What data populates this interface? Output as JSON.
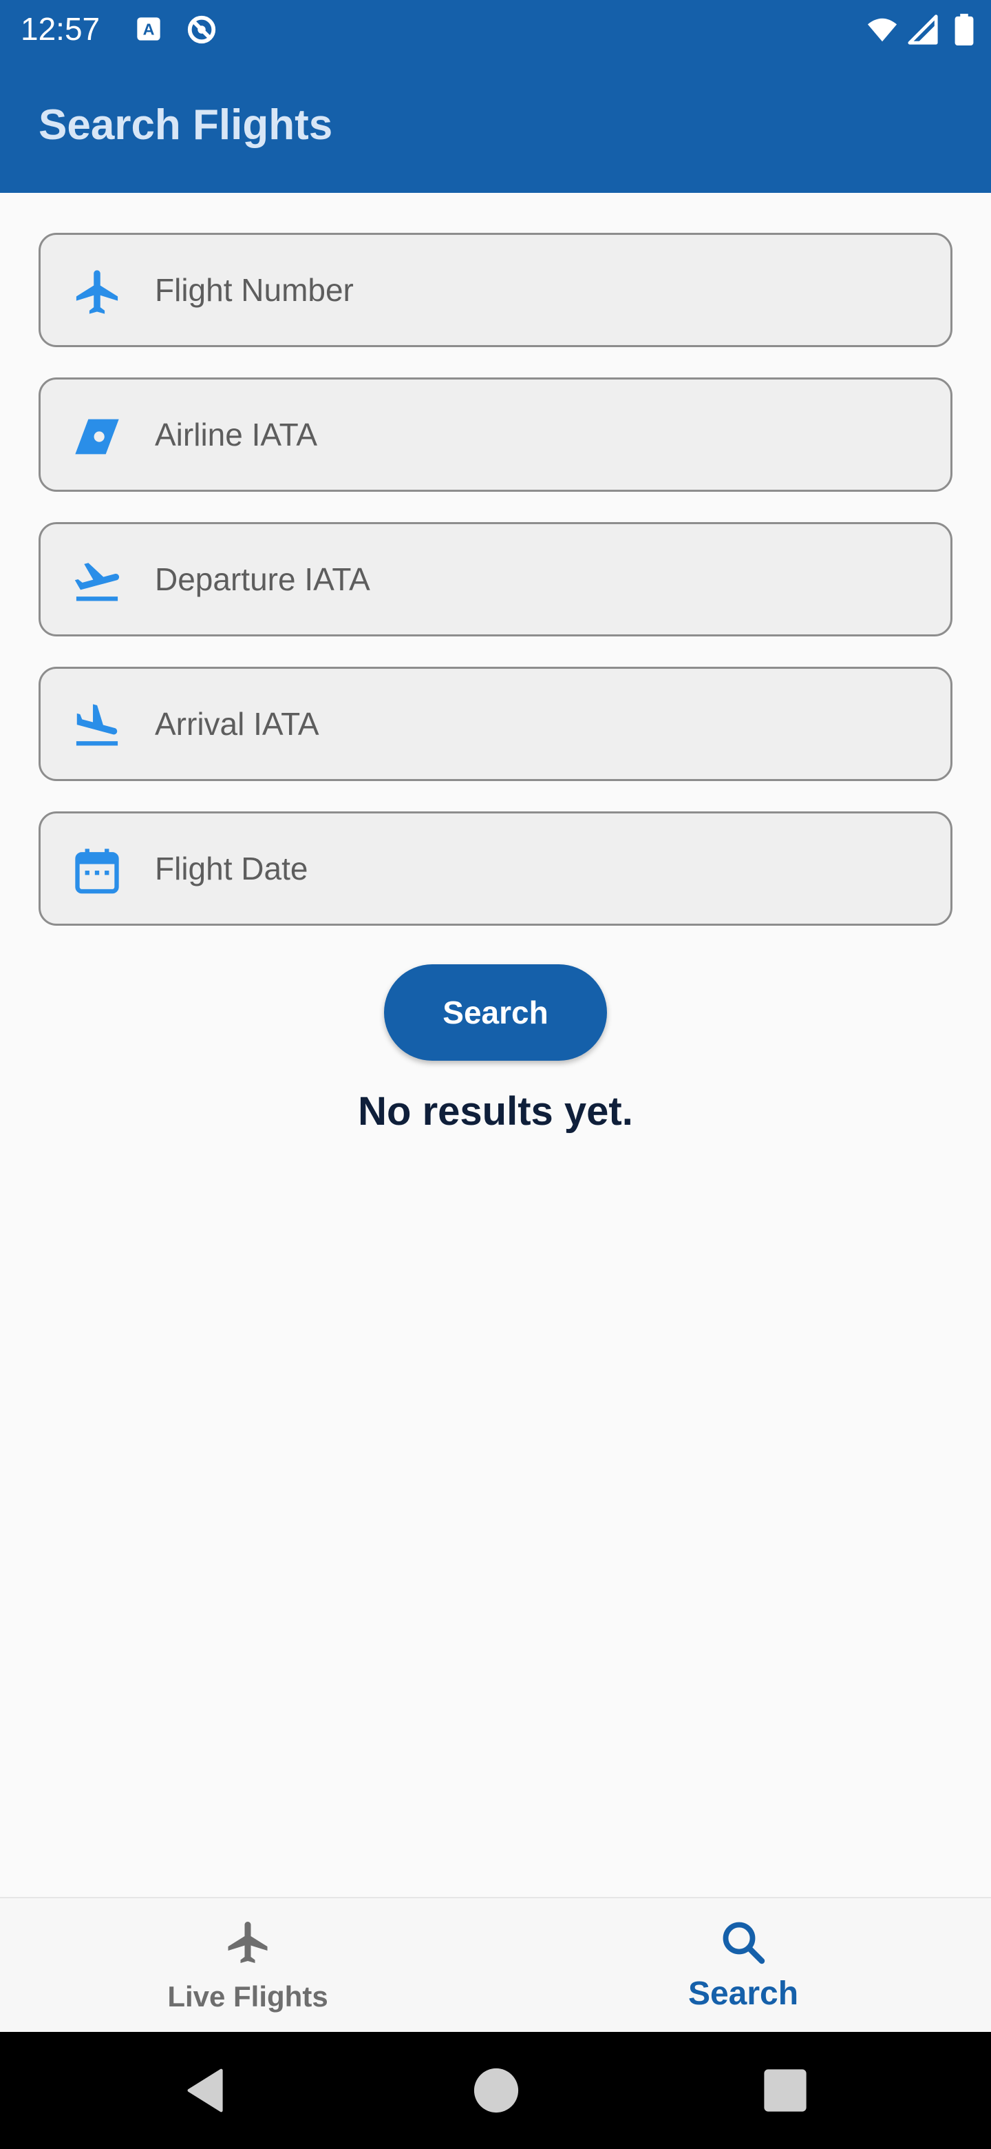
{
  "status_bar": {
    "time": "12:57",
    "icons": [
      "a-accessibility-icon",
      "no-sync-icon",
      "wifi-icon",
      "signal-icon",
      "battery-icon"
    ]
  },
  "app_bar": {
    "title": "Search Flights"
  },
  "form": {
    "fields": [
      {
        "icon": "airplane-icon",
        "placeholder": "Flight Number",
        "value": ""
      },
      {
        "icon": "airline-tail-icon",
        "placeholder": "Airline IATA",
        "value": ""
      },
      {
        "icon": "flight-takeoff-icon",
        "placeholder": "Departure IATA",
        "value": ""
      },
      {
        "icon": "flight-land-icon",
        "placeholder": "Arrival IATA",
        "value": ""
      },
      {
        "icon": "calendar-icon",
        "placeholder": "Flight Date",
        "value": ""
      }
    ],
    "search_label": "Search"
  },
  "results": {
    "empty_text": "No results yet."
  },
  "bottom_nav": {
    "items": [
      {
        "label": "Live Flights",
        "icon": "airplane-icon",
        "active": false
      },
      {
        "label": "Search",
        "icon": "search-icon",
        "active": true
      }
    ]
  },
  "system_nav": {
    "buttons": [
      "back-icon",
      "home-icon",
      "recents-icon"
    ]
  },
  "colors": {
    "primary": "#1560aa",
    "accent_icon": "#2a8ee8",
    "title_text": "#d8e6f6",
    "field_bg": "#efefef",
    "inactive_nav": "#6e6e6e"
  }
}
